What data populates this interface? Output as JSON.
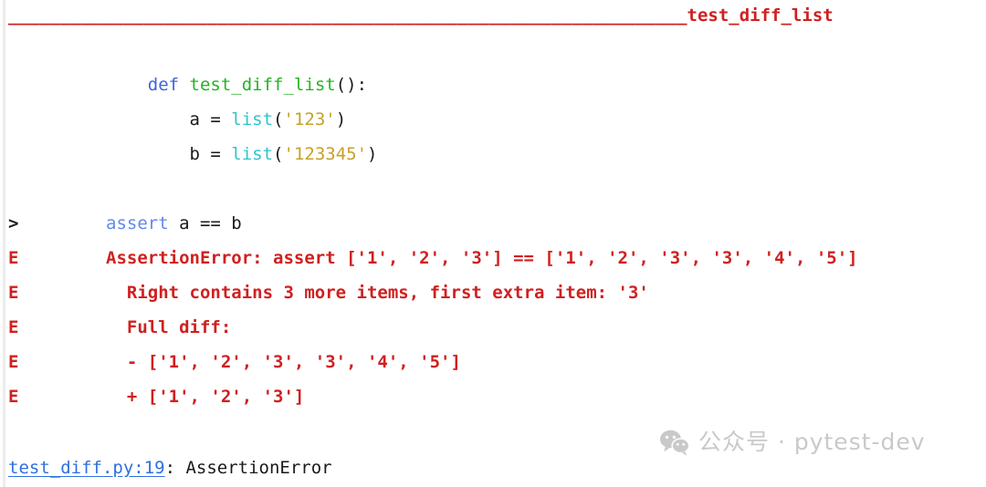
{
  "terminal": {
    "kind": "pytest-failure-report",
    "background_color": "#ffffff",
    "separator": {
      "rule": "_________________________________________________________________",
      "title": "test_diff_list",
      "color": "#d02020"
    },
    "lines": [
      {
        "marker": "",
        "indent": "    ",
        "tokens": [
          {
            "text": "def",
            "style": "kw"
          },
          {
            "text": " ",
            "style": "plain"
          },
          {
            "text": "test_diff_list",
            "style": "fn"
          },
          {
            "text": "():",
            "style": "plain"
          }
        ]
      },
      {
        "marker": "",
        "indent": "        ",
        "tokens": [
          {
            "text": "a = ",
            "style": "plain"
          },
          {
            "text": "list",
            "style": "builtin"
          },
          {
            "text": "(",
            "style": "plain"
          },
          {
            "text": "'123'",
            "style": "str"
          },
          {
            "text": ")",
            "style": "plain"
          }
        ]
      },
      {
        "marker": "",
        "indent": "        ",
        "tokens": [
          {
            "text": "b = ",
            "style": "plain"
          },
          {
            "text": "list",
            "style": "builtin"
          },
          {
            "text": "(",
            "style": "plain"
          },
          {
            "text": "'123345'",
            "style": "str"
          },
          {
            "text": ")",
            "style": "plain"
          }
        ]
      },
      {
        "marker": "",
        "indent": "",
        "tokens": []
      },
      {
        "marker": ">",
        "indent": "",
        "tokens": [
          {
            "text": "assert",
            "style": "kw2"
          },
          {
            "text": " a == b",
            "style": "plain"
          }
        ]
      },
      {
        "marker": "E",
        "indent": "",
        "tokens": [
          {
            "text": "AssertionError: assert ['1', '2', '3'] == ['1', '2', '3', '3', '4', '5']",
            "style": "err"
          }
        ]
      },
      {
        "marker": "E",
        "indent": "  ",
        "tokens": [
          {
            "text": "Right contains 3 more items, first extra item: '3'",
            "style": "err"
          }
        ]
      },
      {
        "marker": "E",
        "indent": "  ",
        "tokens": [
          {
            "text": "Full diff:",
            "style": "err"
          }
        ]
      },
      {
        "marker": "E",
        "indent": "  ",
        "tokens": [
          {
            "text": "- ['1', '2', '3', '3', '4', '5']",
            "style": "err"
          }
        ]
      },
      {
        "marker": "E",
        "indent": "  ",
        "tokens": [
          {
            "text": "+ ['1', '2', '3']",
            "style": "err"
          }
        ]
      }
    ],
    "footer": {
      "link": "test_diff.py:19",
      "rest": ": AssertionError",
      "link_color": "#2f6fe0"
    }
  },
  "watermark": {
    "icon": "wechat-icon",
    "text": "公众号 · pytest-dev",
    "color": "#c9c9c9"
  }
}
